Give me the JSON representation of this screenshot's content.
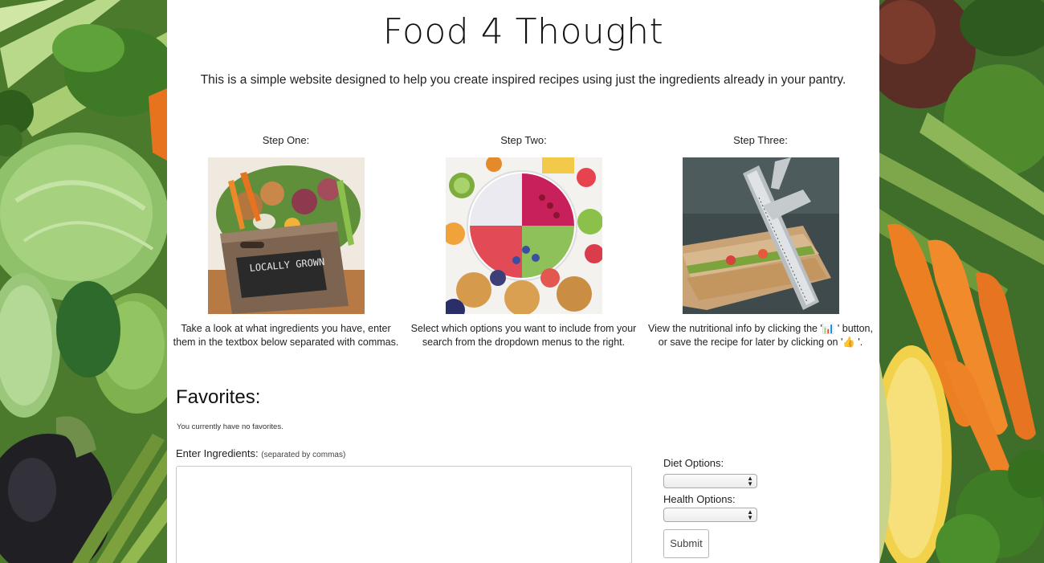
{
  "site": {
    "title": "Food 4 Thought",
    "intro": "This is a simple website designed to help you create inspired recipes using just the ingredients already in your pantry."
  },
  "steps": [
    {
      "title": "Step One:",
      "image_subject": "crate of fresh vegetables with Locally Grown sign",
      "image_text": "LOCALLY GROWN",
      "description": "Take a look at what ingredients you have, enter them in the textbox below separated with commas."
    },
    {
      "title": "Step Two:",
      "image_subject": "smoothie bowl surrounded by fruits and muffins",
      "description": "Select which options you want to include from your search from the dropdown menus to the right."
    },
    {
      "title": "Step Three:",
      "image_subject": "sandwich measured with a caliper",
      "description": "View the nutritional info by clicking the '📊 ' button, or save the recipe for later by clicking on '👍 '."
    }
  ],
  "favorites": {
    "heading": "Favorites:",
    "empty_message": "You currently have no favorites."
  },
  "form": {
    "ingredients_label": "Enter Ingredients:",
    "ingredients_hint": "(separated by commas)",
    "ingredients_value": "",
    "diet_label": "Diet Options:",
    "diet_selected": "",
    "health_label": "Health Options:",
    "health_selected": "",
    "submit_label": "Submit"
  },
  "background": {
    "subject": "assorted green vegetables, carrots, corn and asparagus",
    "colors": {
      "greens": "#4f7f2f",
      "carrot": "#e8731e",
      "corn": "#f2d24a",
      "page": "#ffffff"
    }
  }
}
